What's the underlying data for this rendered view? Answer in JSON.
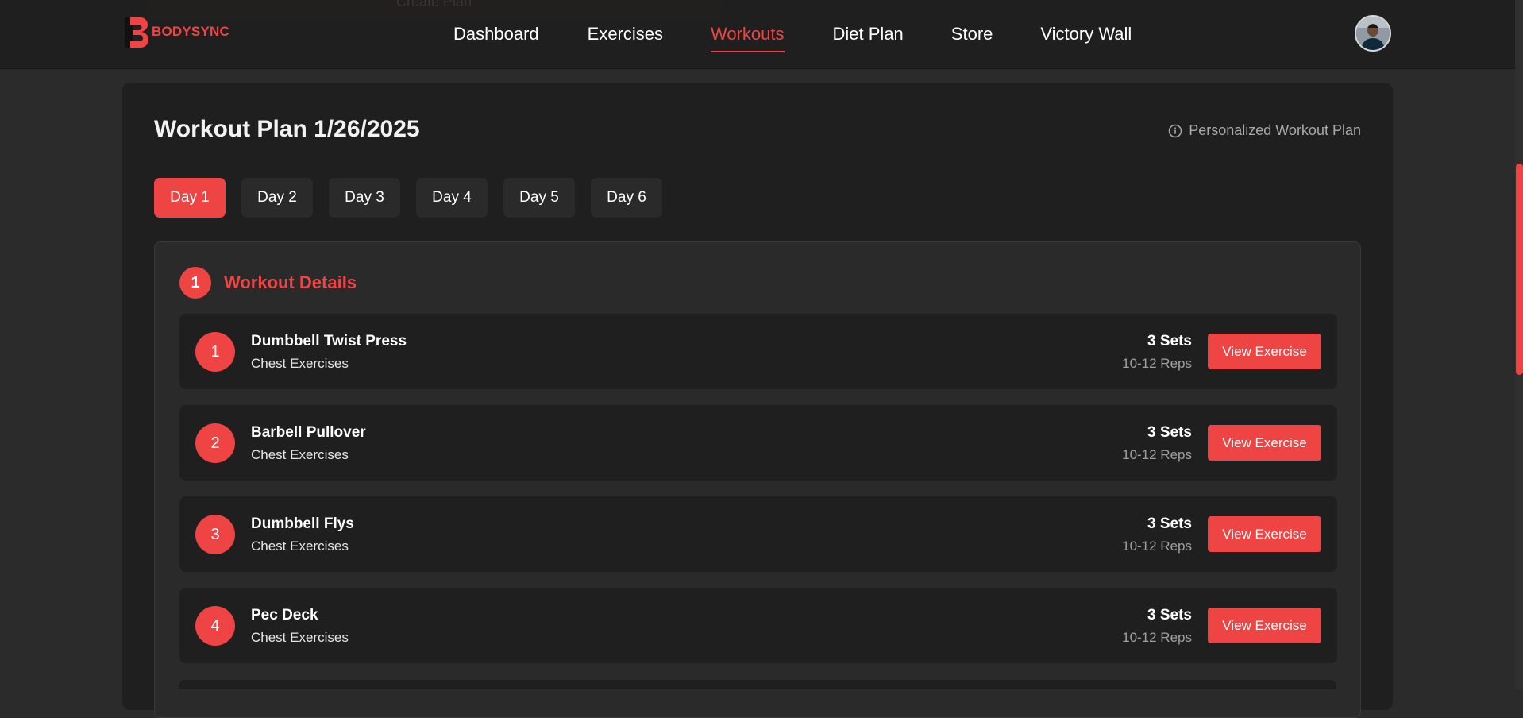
{
  "navbar": {
    "ghost_button": "Create Plan",
    "brand": "BODYSYNC",
    "links": [
      {
        "label": "Dashboard",
        "active": false
      },
      {
        "label": "Exercises",
        "active": false
      },
      {
        "label": "Workouts",
        "active": true
      },
      {
        "label": "Diet Plan",
        "active": false
      },
      {
        "label": "Store",
        "active": false
      },
      {
        "label": "Victory Wall",
        "active": false
      }
    ]
  },
  "page": {
    "title": "Workout Plan 1/26/2025",
    "plan_note": "Personalized Workout Plan",
    "icon": "info-icon"
  },
  "tabs": [
    {
      "label": "Day 1",
      "active": true
    },
    {
      "label": "Day 2",
      "active": false
    },
    {
      "label": "Day 3",
      "active": false
    },
    {
      "label": "Day 4",
      "active": false
    },
    {
      "label": "Day 5",
      "active": false
    },
    {
      "label": "Day 6",
      "active": false
    }
  ],
  "details": {
    "badge": "1",
    "title": "Workout Details",
    "exercises": [
      {
        "num": "1",
        "name": "Dumbbell Twist Press",
        "category": "Chest Exercises",
        "sets": "3 Sets",
        "reps": "10-12 Reps",
        "button": "View Exercise"
      },
      {
        "num": "2",
        "name": "Barbell Pullover",
        "category": "Chest Exercises",
        "sets": "3 Sets",
        "reps": "10-12 Reps",
        "button": "View Exercise"
      },
      {
        "num": "3",
        "name": "Dumbbell Flys",
        "category": "Chest Exercises",
        "sets": "3 Sets",
        "reps": "10-12 Reps",
        "button": "View Exercise"
      },
      {
        "num": "4",
        "name": "Pec Deck",
        "category": "Chest Exercises",
        "sets": "3 Sets",
        "reps": "10-12 Reps",
        "button": "View Exercise"
      }
    ]
  },
  "colors": {
    "accent": "#ef4444",
    "background": "#2b2b2b",
    "card": "#1f1f1f",
    "panel": "#2a2a2a"
  }
}
